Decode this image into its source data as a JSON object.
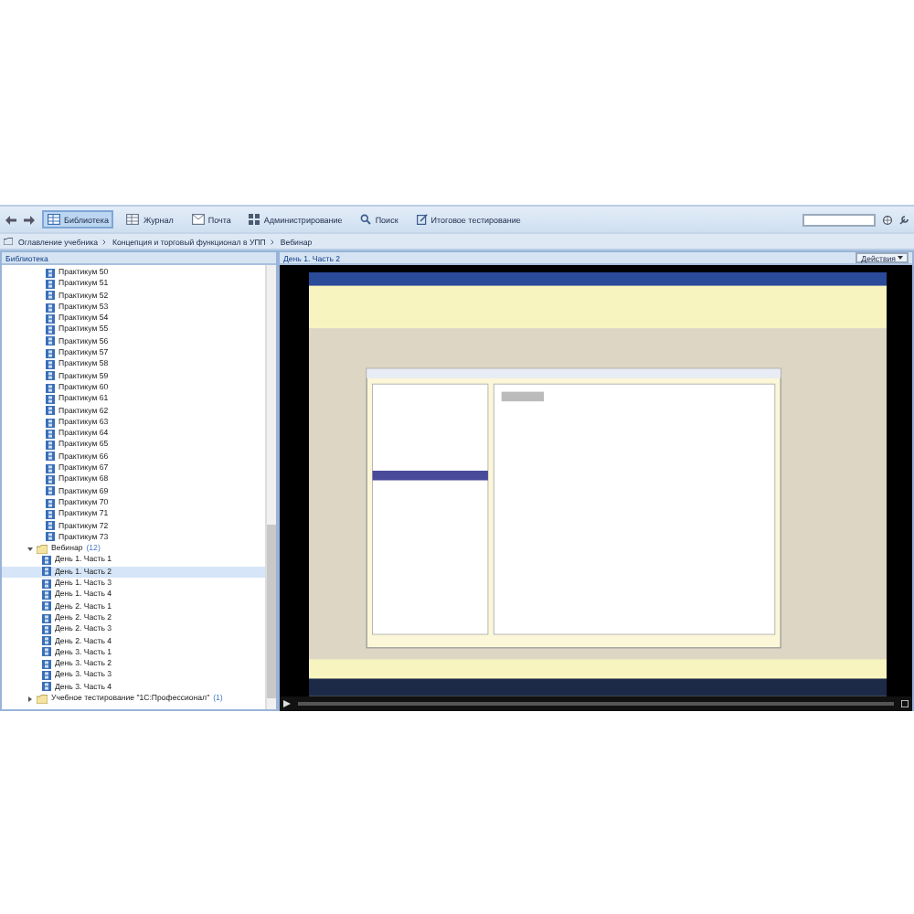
{
  "toolbar": {
    "items": [
      {
        "label": "Библиотека",
        "kind": "library",
        "selected": true
      },
      {
        "label": "Журнал",
        "kind": "journal",
        "selected": false
      },
      {
        "label": "Почта",
        "kind": "mail",
        "selected": false
      },
      {
        "label": "Администрирование",
        "kind": "admin",
        "selected": false
      },
      {
        "label": "Поиск",
        "kind": "search",
        "selected": false
      },
      {
        "label": "Итоговое тестирование",
        "kind": "test",
        "selected": false
      }
    ]
  },
  "breadcrumb": [
    "Оглавление учебника",
    "Концепция и торговый функционал в УПП",
    "Вебинар"
  ],
  "library": {
    "title": "Библиотека",
    "tree": [
      {
        "label": "Практикум 50",
        "kind": "lesson",
        "selected": false
      },
      {
        "label": "Практикум 51",
        "kind": "lesson",
        "selected": false
      },
      {
        "label": "Практикум 52",
        "kind": "lesson",
        "selected": false
      },
      {
        "label": "Практикум 53",
        "kind": "lesson",
        "selected": false
      },
      {
        "label": "Практикум 54",
        "kind": "lesson",
        "selected": false
      },
      {
        "label": "Практикум 55",
        "kind": "lesson",
        "selected": false
      },
      {
        "label": "Практикум 56",
        "kind": "lesson",
        "selected": false
      },
      {
        "label": "Практикум 57",
        "kind": "lesson",
        "selected": false
      },
      {
        "label": "Практикум 58",
        "kind": "lesson",
        "selected": false
      },
      {
        "label": "Практикум 59",
        "kind": "lesson",
        "selected": false
      },
      {
        "label": "Практикум 60",
        "kind": "lesson",
        "selected": false
      },
      {
        "label": "Практикум 61",
        "kind": "lesson",
        "selected": false
      },
      {
        "label": "Практикум 62",
        "kind": "lesson",
        "selected": false
      },
      {
        "label": "Практикум 63",
        "kind": "lesson",
        "selected": false
      },
      {
        "label": "Практикум 64",
        "kind": "lesson",
        "selected": false
      },
      {
        "label": "Практикум 65",
        "kind": "lesson",
        "selected": false
      },
      {
        "label": "Практикум 66",
        "kind": "lesson",
        "selected": false
      },
      {
        "label": "Практикум 67",
        "kind": "lesson",
        "selected": false
      },
      {
        "label": "Практикум 68",
        "kind": "lesson",
        "selected": false
      },
      {
        "label": "Практикум 69",
        "kind": "lesson",
        "selected": false
      },
      {
        "label": "Практикум 70",
        "kind": "lesson",
        "selected": false
      },
      {
        "label": "Практикум 71",
        "kind": "lesson",
        "selected": false
      },
      {
        "label": "Практикум 72",
        "kind": "lesson",
        "selected": false
      },
      {
        "label": "Практикум 73",
        "kind": "lesson",
        "selected": false
      },
      {
        "label": "Вебинар",
        "count": "(12)",
        "kind": "folder",
        "expanded": true,
        "children": [
          {
            "label": "День 1. Часть 1",
            "kind": "lesson",
            "selected": false
          },
          {
            "label": "День 1. Часть 2",
            "kind": "lesson",
            "selected": true
          },
          {
            "label": "День 1. Часть 3",
            "kind": "lesson",
            "selected": false
          },
          {
            "label": "День 1. Часть 4",
            "kind": "lesson",
            "selected": false
          },
          {
            "label": "День 2. Часть 1",
            "kind": "lesson",
            "selected": false
          },
          {
            "label": "День 2. Часть 2",
            "kind": "lesson",
            "selected": false
          },
          {
            "label": "День 2. Часть 3",
            "kind": "lesson",
            "selected": false
          },
          {
            "label": "День 2. Часть 4",
            "kind": "lesson",
            "selected": false
          },
          {
            "label": "День 3. Часть 1",
            "kind": "lesson",
            "selected": false
          },
          {
            "label": "День 3. Часть 2",
            "kind": "lesson",
            "selected": false
          },
          {
            "label": "День 3. Часть 3",
            "kind": "lesson",
            "selected": false
          },
          {
            "label": "День 3. Часть 4",
            "kind": "lesson",
            "selected": false
          }
        ]
      },
      {
        "label": "Учебное тестирование \"1С:Профессионал\"",
        "count": "(1)",
        "kind": "folder",
        "expanded": false
      }
    ]
  },
  "viewer": {
    "title": "День 1. Часть 2",
    "actions": "Действия"
  }
}
